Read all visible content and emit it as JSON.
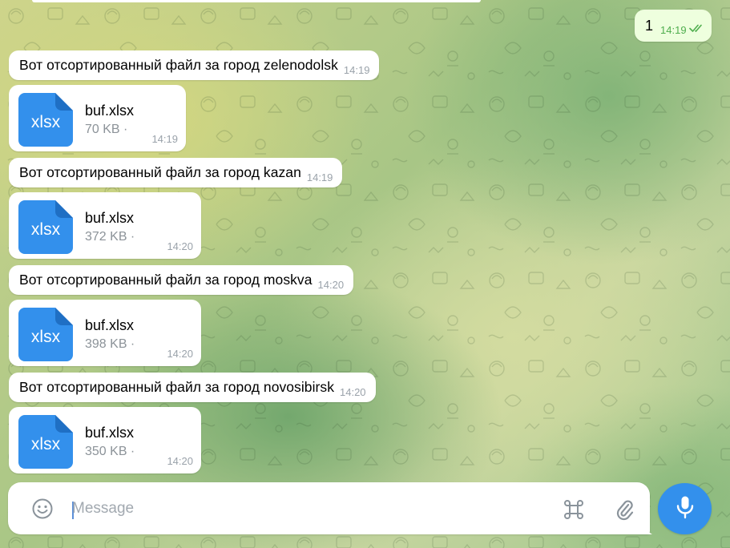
{
  "chat": {
    "outgoing": {
      "text": "1",
      "time": "14:19"
    },
    "messages": [
      {
        "type": "text",
        "text": "Вот отсортированный файл за город zelenodolsk",
        "time": "14:19"
      },
      {
        "type": "file",
        "ext": "xlsx",
        "name": "buf.xlsx",
        "size": "70 KB ·",
        "time": "14:19"
      },
      {
        "type": "text",
        "text": "Вот отсортированный файл за город kazan",
        "time": "14:19"
      },
      {
        "type": "file",
        "ext": "xlsx",
        "name": "buf.xlsx",
        "size": "372 KB ·",
        "time": "14:20"
      },
      {
        "type": "text",
        "text": "Вот отсортированный файл за город moskva",
        "time": "14:20"
      },
      {
        "type": "file",
        "ext": "xlsx",
        "name": "buf.xlsx",
        "size": "398 KB ·",
        "time": "14:20"
      },
      {
        "type": "text",
        "text": "Вот отсортированный файл за город novosibirsk",
        "time": "14:20"
      },
      {
        "type": "file",
        "ext": "xlsx",
        "name": "buf.xlsx",
        "size": "350 KB ·",
        "time": "14:20"
      }
    ]
  },
  "composer": {
    "placeholder": "Message"
  },
  "icons": {
    "emoji": "smile-icon",
    "commands": "command-icon",
    "attach": "paperclip-icon",
    "mic": "microphone-icon",
    "file": "document-icon",
    "read": "double-check-icon"
  },
  "colors": {
    "accent": "#3390ec",
    "file_icon": "#3390ec",
    "outgoing_bubble": "#eeffde",
    "outgoing_time": "#4fae4e"
  }
}
